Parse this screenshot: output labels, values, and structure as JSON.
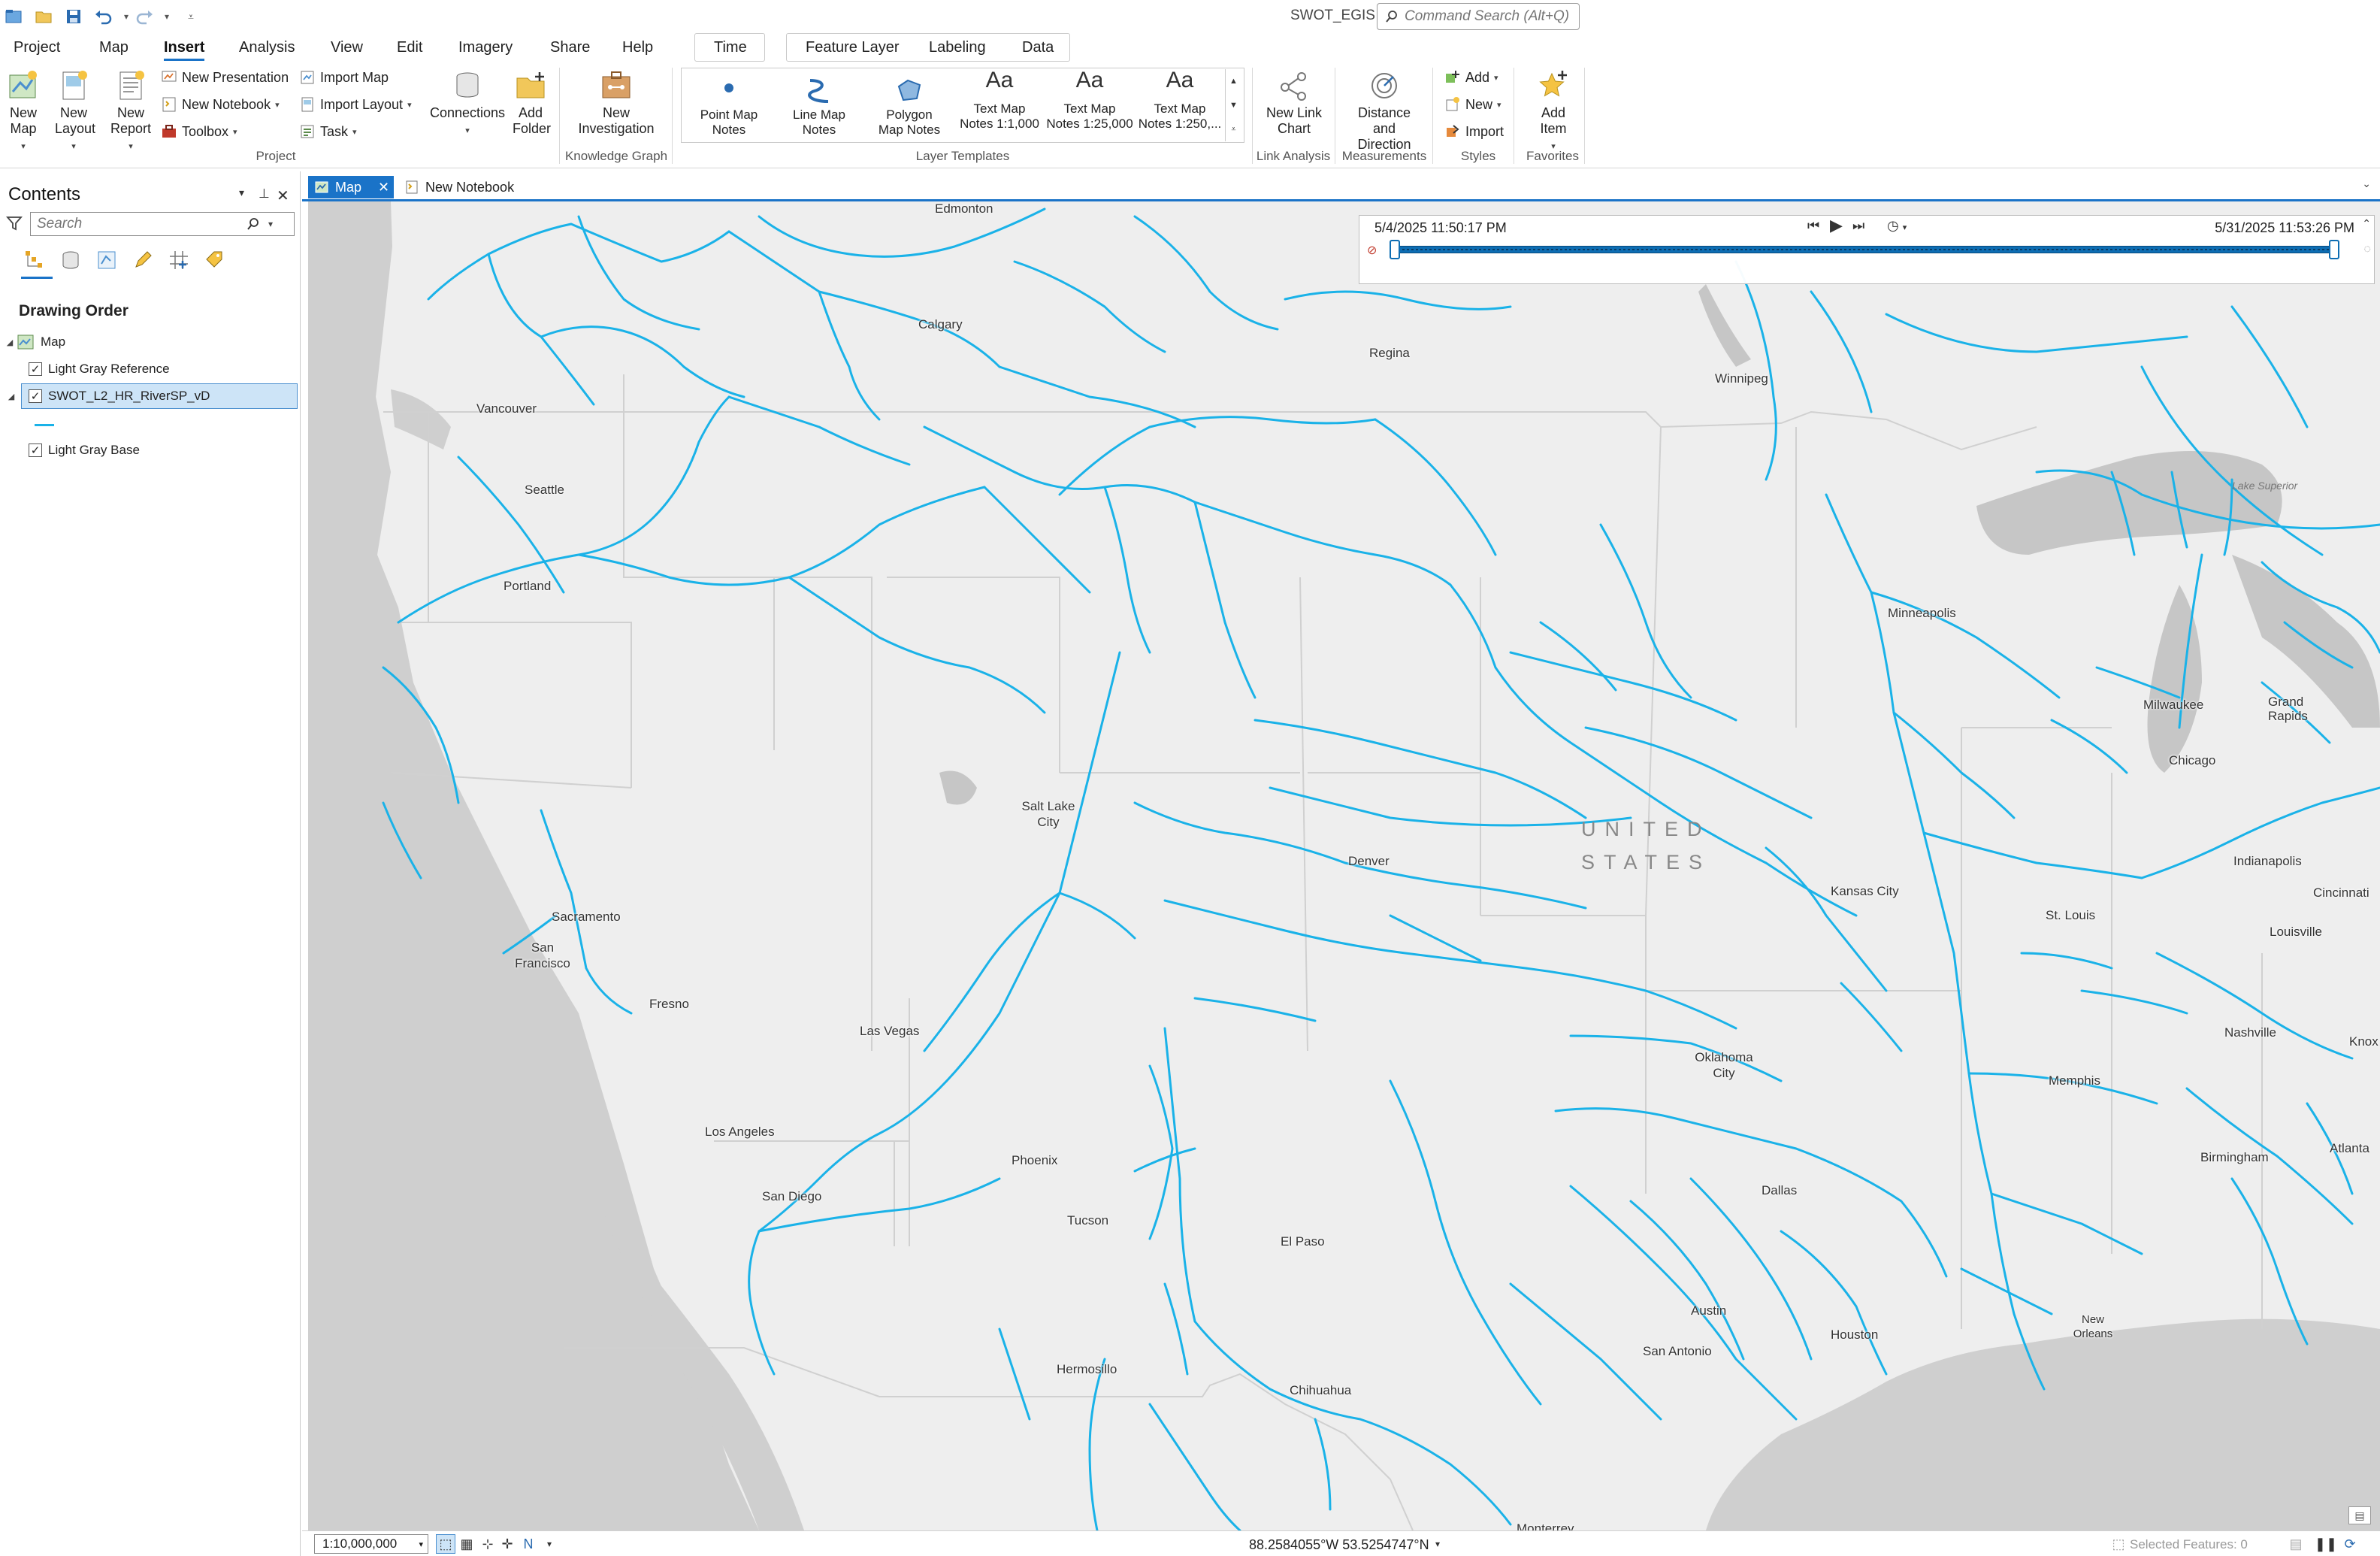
{
  "app": {
    "title": "SWOT_EGIS",
    "command_search_placeholder": "Command Search (Alt+Q)"
  },
  "quick_access": [
    "project-open-icon",
    "folder-open-icon",
    "save-icon",
    "undo-icon",
    "redo-icon",
    "customize-icon"
  ],
  "ribbon_tabs": {
    "project": "Project",
    "map": "Map",
    "insert": "Insert",
    "analysis": "Analysis",
    "view": "View",
    "edit": "Edit",
    "imagery": "Imagery",
    "share": "Share",
    "help": "Help",
    "time": "Time",
    "feature_layer": "Feature Layer",
    "labeling": "Labeling",
    "data": "Data",
    "active": "Insert"
  },
  "ribbon": {
    "new_map": "New Map",
    "new_layout": "New Layout",
    "new_report": "New Report",
    "new_presentation": "New Presentation",
    "new_notebook": "New Notebook",
    "toolbox": "Toolbox",
    "import_map": "Import Map",
    "import_layout": "Import Layout",
    "task": "Task",
    "connections": "Connections",
    "add_folder": "Add Folder",
    "new_investigation": "New Investigation",
    "point_map_notes": "Point Map Notes",
    "line_map_notes": "Line Map Notes",
    "polygon_map_notes": "Polygon Map Notes",
    "text_map_notes_1k": "Text Map Notes 1:1,000",
    "text_map_notes_25k": "Text Map Notes 1:25,000",
    "text_map_notes_250k": "Text Map Notes 1:250,...",
    "new_link_chart": "New Link Chart",
    "distance_and_direction": "Distance and Direction",
    "styles_add": "Add",
    "styles_new": "New",
    "styles_import": "Import",
    "add_item": "Add Item",
    "groups": {
      "project": "Project",
      "knowledge_graph": "Knowledge Graph",
      "layer_templates": "Layer Templates",
      "link_analysis": "Link Analysis",
      "measurements": "Measurements",
      "styles": "Styles",
      "favorites": "Favorites"
    }
  },
  "contents": {
    "title": "Contents",
    "search_placeholder": "Search",
    "drawing_order": "Drawing Order",
    "map_node": "Map",
    "layers": [
      {
        "name": "Light Gray Reference",
        "checked": true,
        "selected": false
      },
      {
        "name": "SWOT_L2_HR_RiverSP_vD",
        "checked": true,
        "selected": true
      },
      {
        "name": "Light Gray Base",
        "checked": true,
        "selected": false
      }
    ],
    "river_symbol_color": "#1ab2e8"
  },
  "view_tabs": {
    "map": "Map",
    "notebook": "New Notebook"
  },
  "time_slider": {
    "start": "5/4/2025 11:50:17 PM",
    "end": "5/31/2025 11:53:26 PM"
  },
  "map_labels": {
    "country": [
      "UNITED",
      "STATES"
    ],
    "lake_superior": "Lake Superior",
    "cities": {
      "edmonton": "Edmonton",
      "calgary": "Calgary",
      "regina": "Regina",
      "winnipeg": "Winnipeg",
      "vancouver": "Vancouver",
      "seattle": "Seattle",
      "portland": "Portland",
      "minneapolis": "Minneapolis",
      "milwaukee": "Milwaukee",
      "grand_rapids": "Grand Rapids",
      "chicago": "Chicago",
      "salt_lake_city": "Salt Lake City",
      "denver": "Denver",
      "kansas_city": "Kansas City",
      "indianapolis": "Indianapolis",
      "cincinnati": "Cincinnati",
      "st_louis": "St. Louis",
      "louisville": "Louisville",
      "sacramento": "Sacramento",
      "san_francisco": "San Francisco",
      "fresno": "Fresno",
      "las_vegas": "Las Vegas",
      "nashville": "Nashville",
      "knoxville": "Knox",
      "memphis": "Memphis",
      "oklahoma_city": "Oklahoma City",
      "los_angeles": "Los Angeles",
      "phoenix": "Phoenix",
      "birmingham": "Birmingham",
      "atlanta": "Atlanta",
      "san_diego": "San Diego",
      "tucson": "Tucson",
      "dallas": "Dallas",
      "el_paso": "El Paso",
      "austin": "Austin",
      "houston": "Houston",
      "new_orleans": "New Orleans",
      "san_antonio": "San Antonio",
      "hermosillo": "Hermosillo",
      "chihuahua": "Chihuahua",
      "monterrey": "Monterrey"
    }
  },
  "status": {
    "scale": "1:10,000,000",
    "coordinates": "88.2584055°W 53.5254747°N",
    "selected_features": "Selected Features: 0"
  },
  "colors": {
    "accent": "#1a73c8",
    "river": "#1ab2e8",
    "land": "#eeeeee",
    "water": "#cfcfcf"
  }
}
